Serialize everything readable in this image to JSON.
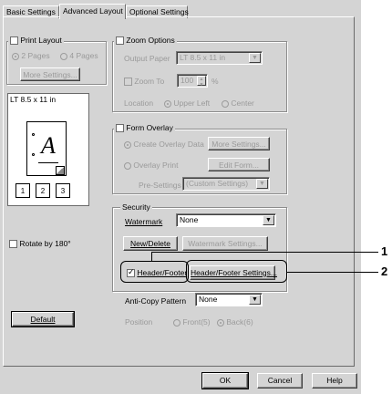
{
  "tabs": [
    {
      "label": "Basic Settings"
    },
    {
      "label": "Advanced Layout"
    },
    {
      "label": "Optional Settings"
    }
  ],
  "print_layout": {
    "title": "Print Layout",
    "checked": false,
    "option_2pages": "2 Pages",
    "option_4pages": "4 Pages",
    "more_settings": "More Settings..."
  },
  "preview": {
    "paper_label": "LT 8.5 x 11 in",
    "letter": "A",
    "page_icons": [
      "1",
      "2",
      "3"
    ]
  },
  "rotate": {
    "label": "Rotate by 180°"
  },
  "default_button": "Default",
  "zoom": {
    "title": "Zoom Options",
    "checked": false,
    "output_paper_label": "Output Paper",
    "output_paper_value": "LT 8.5 x 11 in",
    "zoom_to_label": "Zoom To",
    "zoom_value": "100",
    "zoom_unit": "%",
    "location_label": "Location",
    "upper_left": "Upper Left",
    "center": "Center"
  },
  "form_overlay": {
    "title": "Form Overlay",
    "checked": false,
    "create_overlay": "Create Overlay Data",
    "more_settings": "More Settings...",
    "overlay_print": "Overlay Print",
    "edit_form": "Edit Form...",
    "pre_settings_label": "Pre-Settings",
    "pre_settings_value": "(Custom Settings)"
  },
  "security": {
    "title": "Security",
    "watermark_label": "Watermark",
    "watermark_value": "None",
    "new_delete": "New/Delete",
    "watermark_settings": "Watermark Settings...",
    "header_footer_label": "Header/Footer",
    "header_footer_checked": true,
    "header_footer_settings": "Header/Footer Settings..."
  },
  "anti_copy": {
    "label": "Anti-Copy Pattern",
    "value": "None",
    "position_label": "Position",
    "front": "Front(5)",
    "back": "Back(6)"
  },
  "footer_buttons": {
    "ok": "OK",
    "cancel": "Cancel",
    "help": "Help"
  },
  "callouts": {
    "one": "1",
    "two": "2"
  }
}
